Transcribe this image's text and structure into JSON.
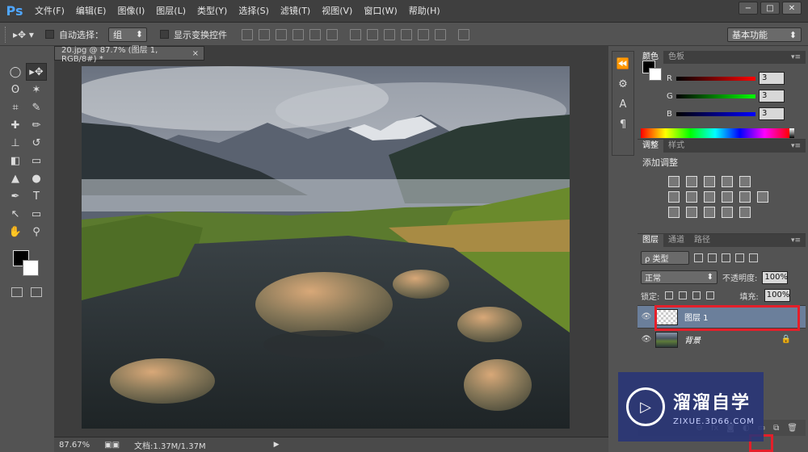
{
  "app": {
    "logo": "Ps",
    "menus": [
      "文件(F)",
      "编辑(E)",
      "图像(I)",
      "图层(L)",
      "类型(Y)",
      "选择(S)",
      "滤镜(T)",
      "视图(V)",
      "窗口(W)",
      "帮助(H)"
    ]
  },
  "options": {
    "auto_select_label": "自动选择：",
    "auto_select_value": "组",
    "show_transform_label": "显示变换控件",
    "workspace": "基本功能"
  },
  "document": {
    "tab_title": "20.jpg @ 87.7% (图层 1, RGB/8#) *",
    "tab_close": "×"
  },
  "status": {
    "zoom": "87.67%",
    "doc_info": "文档:1.37M/1.37M"
  },
  "color_panel": {
    "tabs": [
      "颜色",
      "色板"
    ],
    "r_label": "R",
    "g_label": "G",
    "b_label": "B",
    "r_value": "3",
    "g_value": "3",
    "b_value": "3"
  },
  "adjust_panel": {
    "tabs": [
      "调整",
      "样式"
    ],
    "title": "添加调整"
  },
  "layers_panel": {
    "tabs": [
      "图层",
      "通道",
      "路径"
    ],
    "filter_label": "ρ 类型",
    "blend_mode": "正常",
    "opacity_label": "不透明度:",
    "opacity_value": "100%",
    "lock_label": "锁定:",
    "fill_label": "填充:",
    "fill_value": "100%",
    "layers": [
      {
        "name": "图层 1"
      },
      {
        "name": "背景"
      }
    ]
  },
  "watermark": {
    "title": "溜溜自学",
    "url": "ZIXUE.3D66.COM"
  },
  "colors": {
    "highlight_red": "#e41f2a",
    "selected_layer": "#6b7f9b",
    "ps_blue": "#4fa6ff"
  }
}
